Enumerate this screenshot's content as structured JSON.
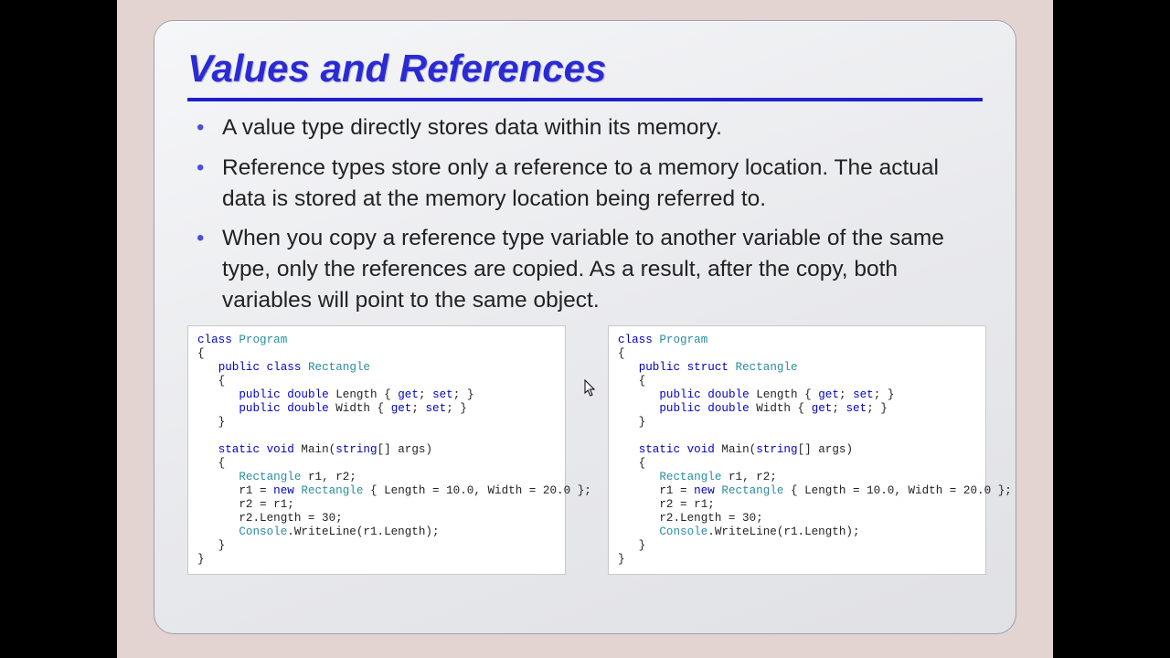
{
  "slide": {
    "title": "Values and References",
    "bullets": [
      "A value type directly stores data within its memory.",
      "Reference types store only a reference to a memory location. The actual data is stored at the memory location being referred to.",
      "When you copy a reference type variable to another variable of the same type, only the references are copied. As a result, after the copy, both variables will point to the same object."
    ],
    "code_left": {
      "declaration_kind": "class",
      "tokens": {
        "class": "class",
        "Program": "Program",
        "public": "public",
        "Rectangle": "Rectangle",
        "double": "double",
        "Length": "Length",
        "Width": "Width",
        "get": "get",
        "set": "set",
        "static": "static",
        "void": "void",
        "Main": "Main",
        "string": "string",
        "args": "args",
        "new": "new",
        "init": "{ Length = 10.0, Width = 20.0 }",
        "assign": "r2.Length = 30;",
        "Console": "Console",
        "call": ".WriteLine(r1.Length);"
      }
    },
    "code_right": {
      "declaration_kind": "struct",
      "tokens": {
        "class": "class",
        "Program": "Program",
        "public": "public",
        "Rectangle": "Rectangle",
        "double": "double",
        "Length": "Length",
        "Width": "Width",
        "get": "get",
        "set": "set",
        "static": "static",
        "void": "void",
        "Main": "Main",
        "string": "string",
        "args": "args",
        "new": "new",
        "init": "{ Length = 10.0, Width = 20.0 }",
        "assign": "r2.Length = 30;",
        "Console": "Console",
        "call": ".WriteLine(r1.Length);"
      }
    }
  }
}
